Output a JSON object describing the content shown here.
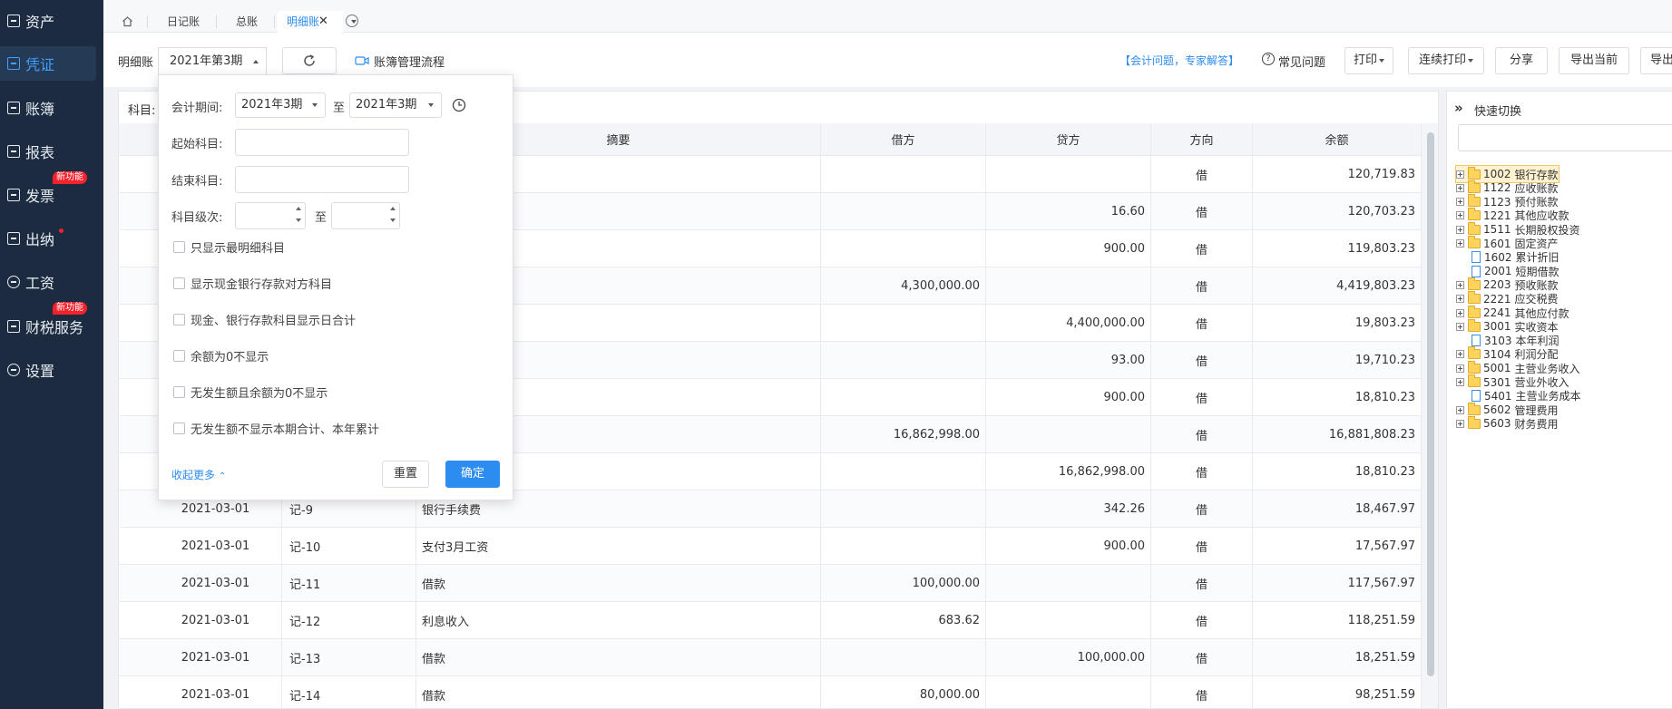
{
  "sidebar": {
    "items": [
      {
        "label": "资产"
      },
      {
        "label": "凭证"
      },
      {
        "label": "账簿"
      },
      {
        "label": "报表"
      },
      {
        "label": "发票",
        "badge": "新功能"
      },
      {
        "label": "出纳"
      },
      {
        "label": "工资"
      },
      {
        "label": "财税服务",
        "badge": "新功能"
      },
      {
        "label": "设置"
      }
    ]
  },
  "tabs": [
    "日记账",
    "总账",
    "明细账"
  ],
  "toolbar": {
    "ledger_label": "明细账",
    "period_value": "2021年第3期",
    "process_link": "账簿管理流程",
    "expert_link": "【会计问题，专家解答】",
    "faq": "常见问题",
    "print": "打印",
    "continuous_print": "连续打印",
    "share": "分享",
    "export_current": "导出当前",
    "export_more": "导出"
  },
  "filter": {
    "subject_label": "科目:",
    "period_label": "会计期间:",
    "period_from": "2021年3期",
    "to": "至",
    "period_to": "2021年3期",
    "start_subject_label": "起始科目:",
    "end_subject_label": "结束科目:",
    "level_label": "科目级次:",
    "options": [
      "只显示最明细科目",
      "显示现金银行存款对方科目",
      "现金、银行存款科目显示日合计",
      "余额为0不显示",
      "无发生额且余额为0不显示",
      "无发生额不显示本期合计、本年累计"
    ],
    "collapse_more": "收起更多",
    "reset": "重置",
    "confirm": "确定"
  },
  "table": {
    "headers": {
      "summary": "摘要",
      "debit": "借方",
      "credit": "贷方",
      "direction": "方向",
      "balance": "余额"
    },
    "rows": [
      {
        "date": "",
        "voucher": "",
        "summary": "",
        "debit": "",
        "credit": "",
        "direction": "借",
        "balance": "120,719.83"
      },
      {
        "date": "",
        "voucher": "",
        "summary": "",
        "debit": "",
        "credit": "16.60",
        "direction": "借",
        "balance": "120,703.23"
      },
      {
        "date": "",
        "voucher": "",
        "summary": "",
        "debit": "",
        "credit": "900.00",
        "direction": "借",
        "balance": "119,803.23"
      },
      {
        "date": "",
        "voucher": "",
        "summary": "",
        "debit": "4,300,000.00",
        "credit": "",
        "direction": "借",
        "balance": "4,419,803.23"
      },
      {
        "date": "",
        "voucher": "",
        "summary": "",
        "debit": "",
        "credit": "4,400,000.00",
        "direction": "借",
        "balance": "19,803.23"
      },
      {
        "date": "",
        "voucher": "",
        "summary": "",
        "debit": "",
        "credit": "93.00",
        "direction": "借",
        "balance": "19,710.23"
      },
      {
        "date": "",
        "voucher": "",
        "summary": "",
        "debit": "",
        "credit": "900.00",
        "direction": "借",
        "balance": "18,810.23"
      },
      {
        "date": "",
        "voucher": "",
        "summary": "",
        "debit": "16,862,998.00",
        "credit": "",
        "direction": "借",
        "balance": "16,881,808.23"
      },
      {
        "date": "",
        "voucher": "",
        "summary": "",
        "debit": "",
        "credit": "16,862,998.00",
        "direction": "借",
        "balance": "18,810.23"
      },
      {
        "date": "2021-03-01",
        "voucher": "记-9",
        "summary": "银行手续费",
        "debit": "",
        "credit": "342.26",
        "direction": "借",
        "balance": "18,467.97"
      },
      {
        "date": "2021-03-01",
        "voucher": "记-10",
        "summary": "支付3月工资",
        "debit": "",
        "credit": "900.00",
        "direction": "借",
        "balance": "17,567.97"
      },
      {
        "date": "2021-03-01",
        "voucher": "记-11",
        "summary": "借款",
        "debit": "100,000.00",
        "credit": "",
        "direction": "借",
        "balance": "117,567.97"
      },
      {
        "date": "2021-03-01",
        "voucher": "记-12",
        "summary": "利息收入",
        "debit": "683.62",
        "credit": "",
        "direction": "借",
        "balance": "118,251.59"
      },
      {
        "date": "2021-03-01",
        "voucher": "记-13",
        "summary": "借款",
        "debit": "",
        "credit": "100,000.00",
        "direction": "借",
        "balance": "18,251.59"
      },
      {
        "date": "2021-03-01",
        "voucher": "记-14",
        "summary": "借款",
        "debit": "80,000.00",
        "credit": "",
        "direction": "借",
        "balance": "98,251.59"
      }
    ]
  },
  "quick_switch": {
    "title": "快速切换",
    "items": [
      {
        "code": "1002",
        "name": "银行存款",
        "type": "folder",
        "selected": true
      },
      {
        "code": "1122",
        "name": "应收账款",
        "type": "folder"
      },
      {
        "code": "1123",
        "name": "预付账款",
        "type": "folder"
      },
      {
        "code": "1221",
        "name": "其他应收款",
        "type": "folder"
      },
      {
        "code": "1511",
        "name": "长期股权投资",
        "type": "folder"
      },
      {
        "code": "1601",
        "name": "固定资产",
        "type": "folder"
      },
      {
        "code": "1602",
        "name": "累计折旧",
        "type": "file"
      },
      {
        "code": "2001",
        "name": "短期借款",
        "type": "file"
      },
      {
        "code": "2203",
        "name": "预收账款",
        "type": "folder"
      },
      {
        "code": "2221",
        "name": "应交税费",
        "type": "folder"
      },
      {
        "code": "2241",
        "name": "其他应付款",
        "type": "folder"
      },
      {
        "code": "3001",
        "name": "实收资本",
        "type": "folder"
      },
      {
        "code": "3103",
        "name": "本年利润",
        "type": "file"
      },
      {
        "code": "3104",
        "name": "利润分配",
        "type": "folder"
      },
      {
        "code": "5001",
        "name": "主营业务收入",
        "type": "folder"
      },
      {
        "code": "5301",
        "name": "营业外收入",
        "type": "folder"
      },
      {
        "code": "5401",
        "name": "主营业务成本",
        "type": "file"
      },
      {
        "code": "5602",
        "name": "管理费用",
        "type": "folder"
      },
      {
        "code": "5603",
        "name": "财务费用",
        "type": "folder"
      }
    ]
  },
  "colors": {
    "accent": "#2d8cf0",
    "sidebar_bg": "#1c2b3f",
    "badge": "#f5222d",
    "folder": "#ffd35c"
  }
}
